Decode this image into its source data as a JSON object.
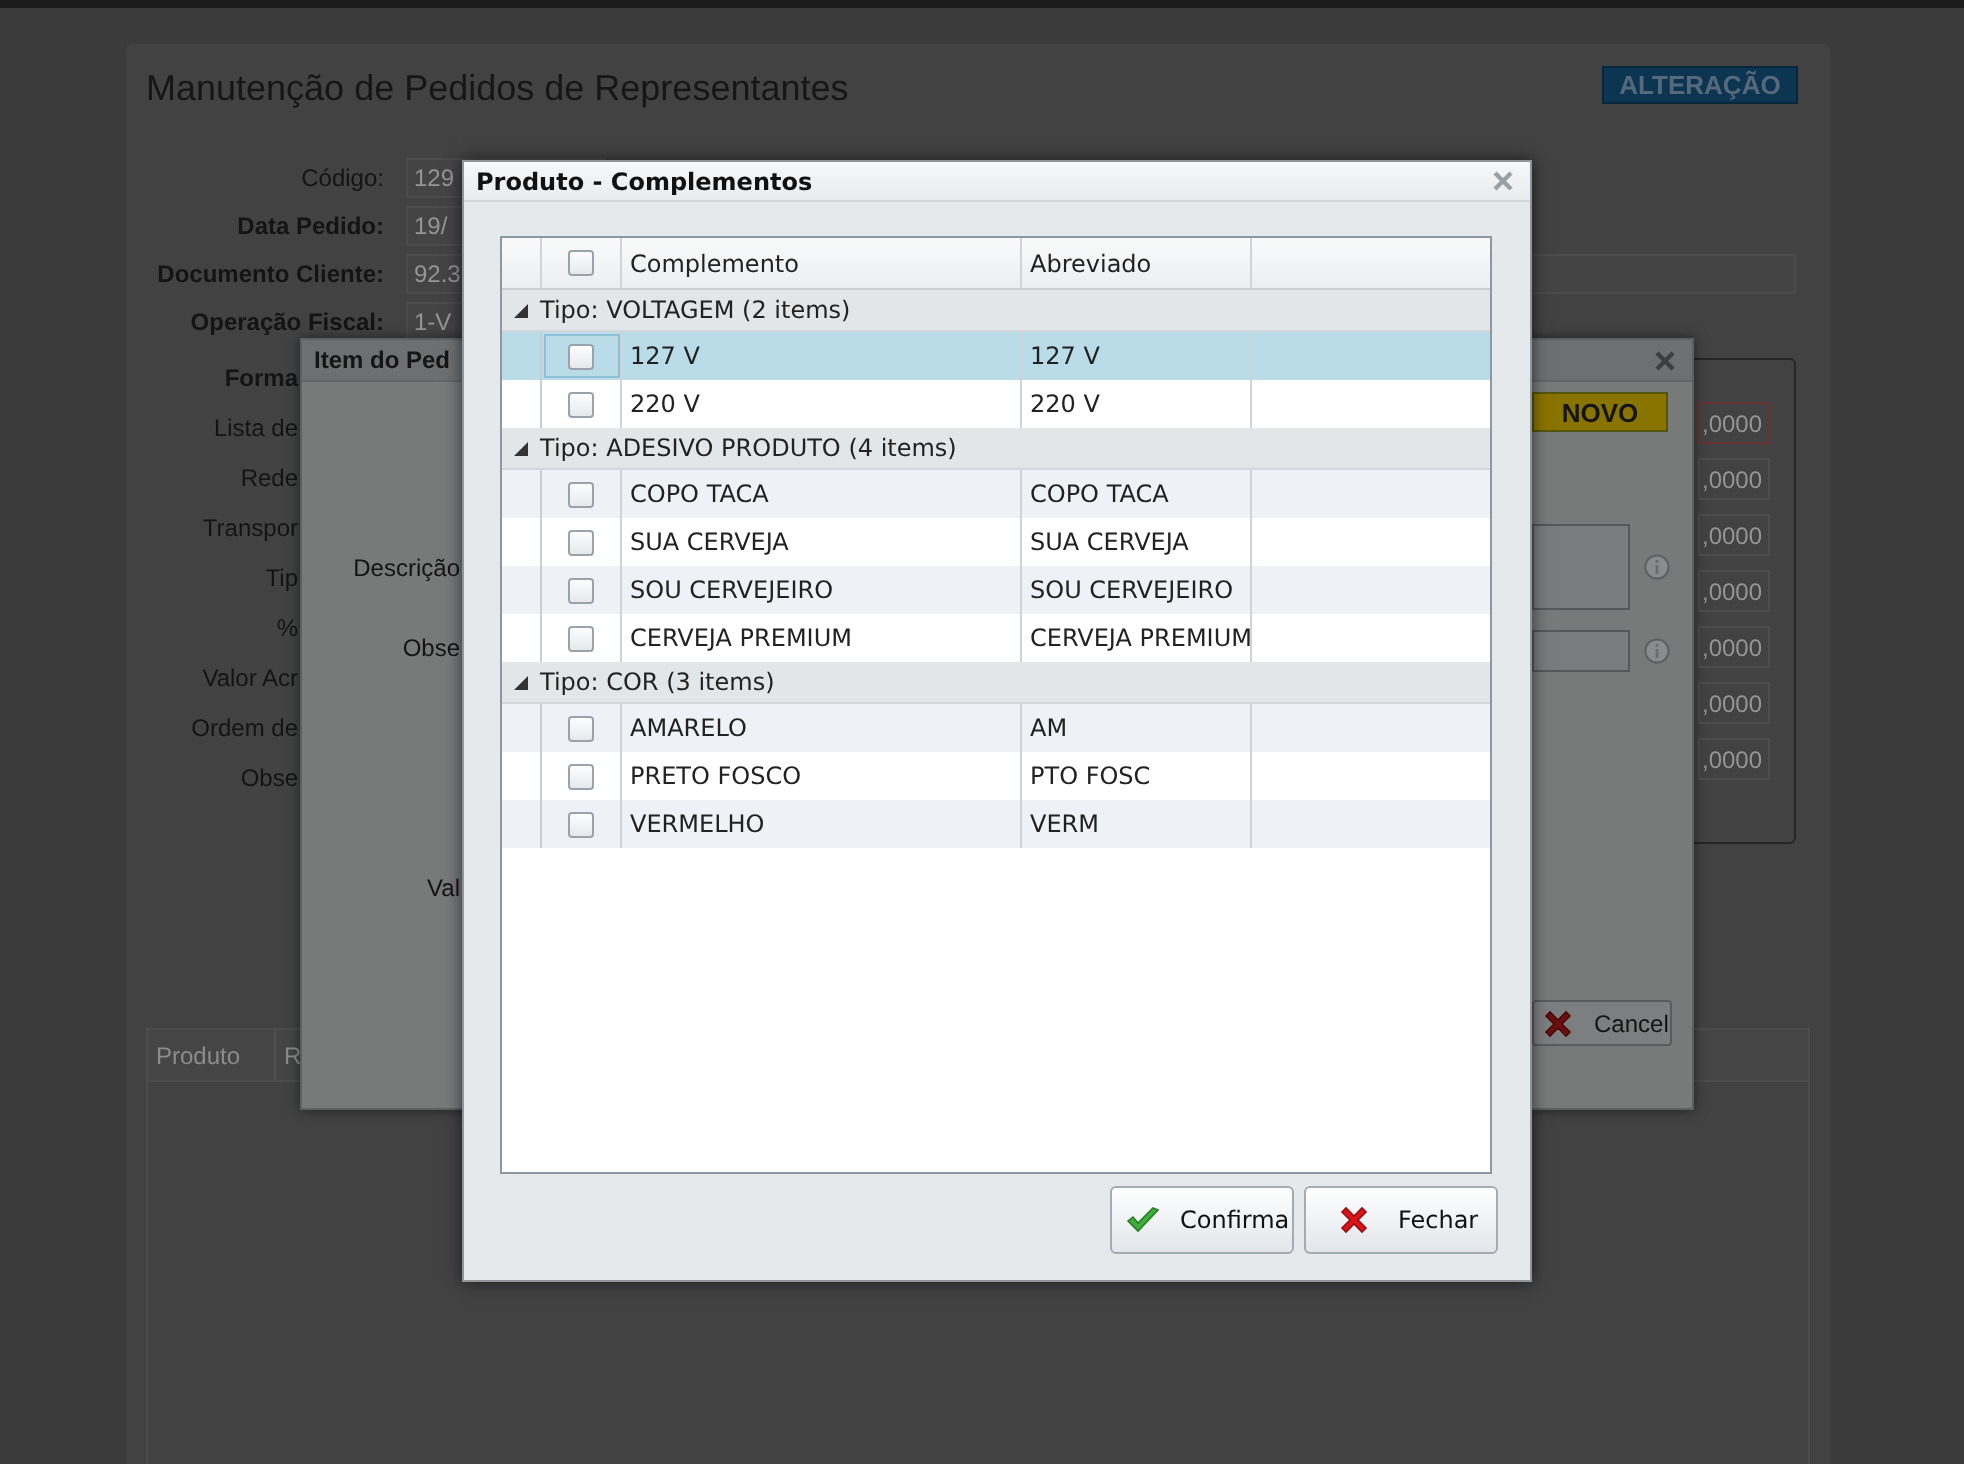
{
  "background_page": {
    "title": "Manutenção de Pedidos de Representantes",
    "mode_badge": "ALTERAÇÃO",
    "fields": [
      {
        "label": "Código:",
        "bold": false,
        "value": "129"
      },
      {
        "label": "Data Pedido:",
        "bold": true,
        "value": "19/"
      },
      {
        "label": "Documento Cliente:",
        "bold": true,
        "value": "92.3"
      },
      {
        "label": "Operação Fiscal:",
        "bold": true,
        "value": "1-V"
      }
    ],
    "more_labels": [
      {
        "label": "Forma",
        "bold": true
      },
      {
        "label": "Lista de",
        "bold": false
      },
      {
        "label": "Rede",
        "bold": false
      },
      {
        "label": "Transpor",
        "bold": false
      },
      {
        "label": "Tip",
        "bold": false
      },
      {
        "label": "%",
        "bold": false
      },
      {
        "label": "Valor Acr",
        "bold": false
      },
      {
        "label": "Ordem de",
        "bold": false
      },
      {
        "label": "Obse",
        "bold": false
      }
    ],
    "totals": [
      {
        "value": ",0000",
        "error": true
      },
      {
        "value": ",0000",
        "error": false
      },
      {
        "value": ",0000",
        "error": false
      },
      {
        "value": ",0000",
        "error": false
      },
      {
        "value": ",0000",
        "error": false
      },
      {
        "value": ",0000",
        "error": false
      },
      {
        "value": ",0000",
        "error": false
      }
    ],
    "grid": {
      "columns": [
        "Produto",
        "R"
      ]
    }
  },
  "item_dialog": {
    "title": "Item do Ped",
    "status_badge": "NOVO",
    "labels": [
      "Descrição",
      "Obse",
      "Val"
    ],
    "buttons": [
      {
        "label": "Cancel",
        "kind": "close"
      }
    ]
  },
  "complementos_dialog": {
    "title": "Produto - Complementos",
    "header_checked": false,
    "columns": [
      "Complemento",
      "Abreviado"
    ],
    "groups": [
      {
        "label": "Tipo: VOLTAGEM (2 items)",
        "expanded": true,
        "rows": [
          {
            "complemento": "127 V",
            "abreviado": "127 V",
            "checked": false,
            "selected": true
          },
          {
            "complemento": "220 V",
            "abreviado": "220 V",
            "checked": false,
            "selected": false
          }
        ]
      },
      {
        "label": "Tipo: ADESIVO PRODUTO (4 items)",
        "expanded": true,
        "rows": [
          {
            "complemento": "COPO TACA",
            "abreviado": "COPO TACA",
            "checked": false,
            "selected": false
          },
          {
            "complemento": "SUA CERVEJA",
            "abreviado": "SUA CERVEJA",
            "checked": false,
            "selected": false
          },
          {
            "complemento": "SOU CERVEJEIRO",
            "abreviado": "SOU CERVEJEIRO",
            "checked": false,
            "selected": false
          },
          {
            "complemento": "CERVEJA PREMIUM",
            "abreviado": "CERVEJA PREMIUM",
            "checked": false,
            "selected": false
          }
        ]
      },
      {
        "label": "Tipo: COR (3 items)",
        "expanded": true,
        "rows": [
          {
            "complemento": "AMARELO",
            "abreviado": "AM",
            "checked": false,
            "selected": false
          },
          {
            "complemento": "PRETO FOSCO",
            "abreviado": "PTO FOSC",
            "checked": false,
            "selected": false
          },
          {
            "complemento": "VERMELHO",
            "abreviado": "VERM",
            "checked": false,
            "selected": false
          }
        ]
      }
    ],
    "buttons": [
      {
        "label": "Confirma",
        "kind": "confirm"
      },
      {
        "label": "Fechar",
        "kind": "close"
      }
    ]
  }
}
